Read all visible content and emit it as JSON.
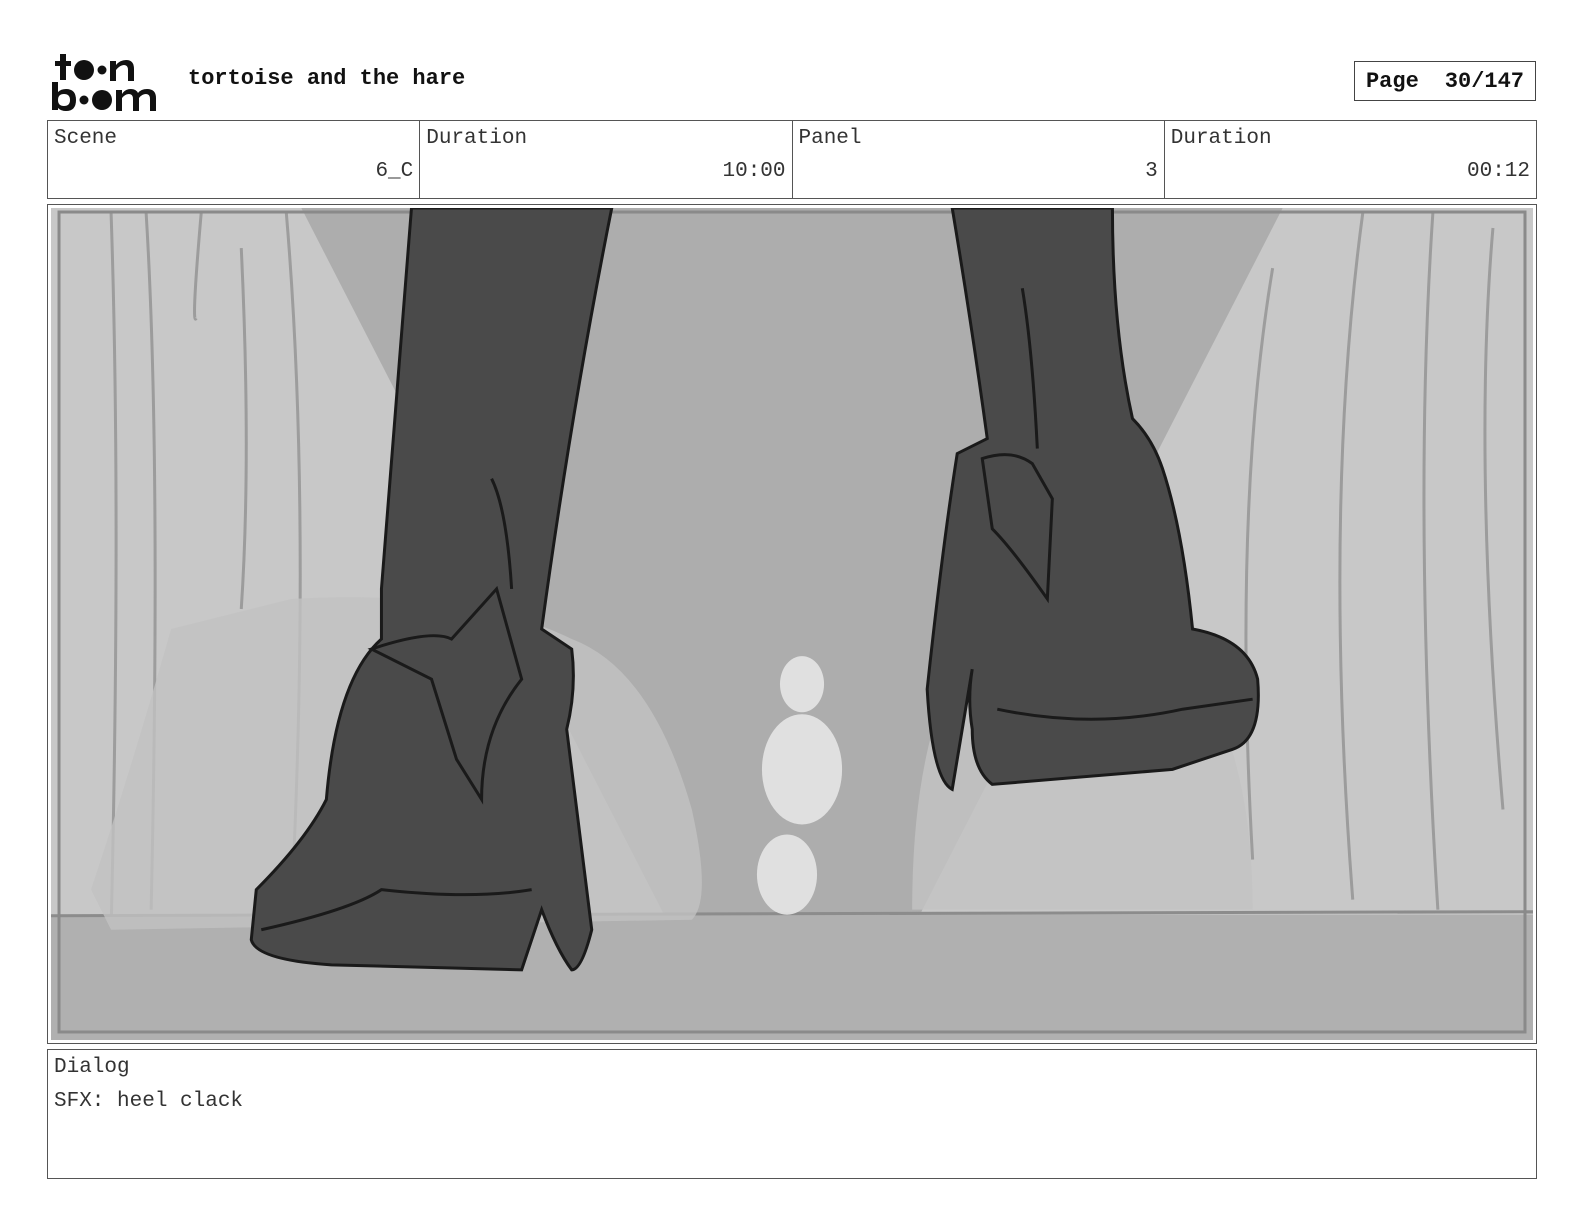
{
  "header": {
    "logo_name": "toonboom",
    "project_title": "tortoise and the hare",
    "page_label": "Page",
    "page_value": "30/147"
  },
  "info": {
    "scene_label": "Scene",
    "scene_value": "6_C",
    "scene_duration_label": "Duration",
    "scene_duration_value": "10:00",
    "panel_label": "Panel",
    "panel_value": "3",
    "panel_duration_label": "Duration",
    "panel_duration_value": "00:12"
  },
  "panel": {
    "image_icon": "storyboard-sketch-two-heeled-boots-walking",
    "colors": {
      "background": "#c8c8c8",
      "spotlight": "#adadad",
      "boots": "#4a4a4a",
      "outline": "#1a1a1a"
    }
  },
  "dialog": {
    "label": "Dialog",
    "text": "SFX: heel clack"
  }
}
